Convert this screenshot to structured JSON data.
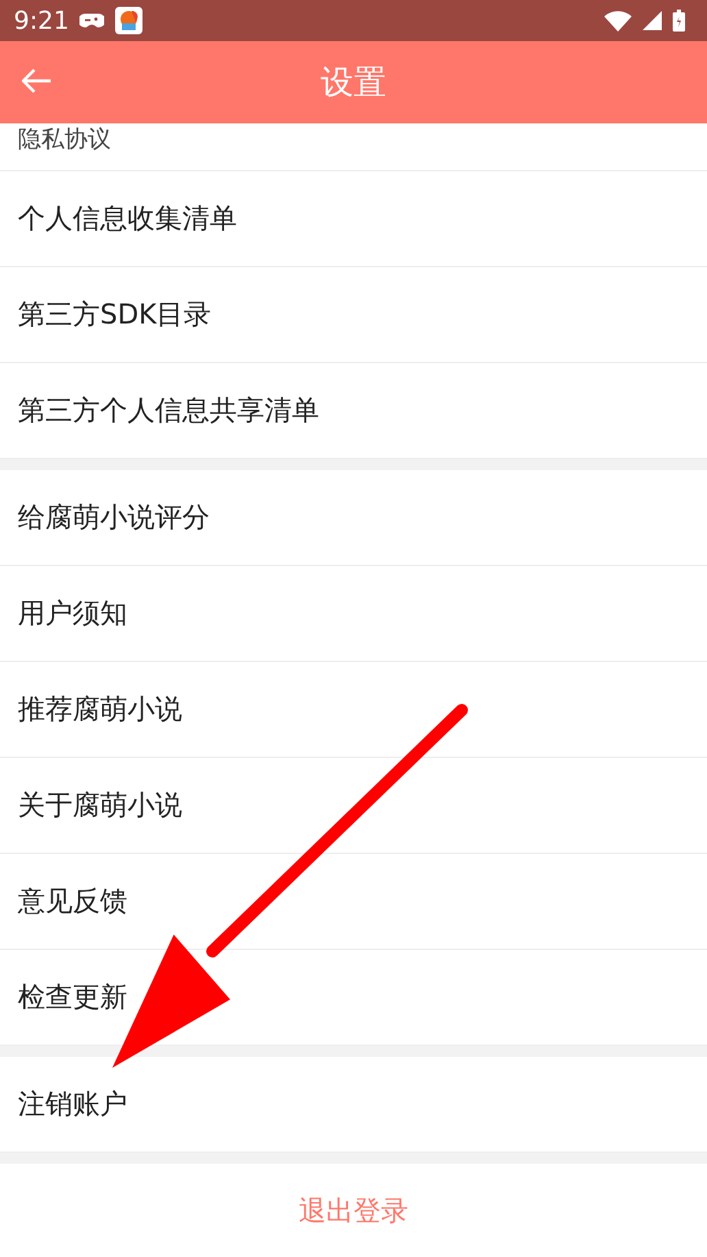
{
  "status_bar": {
    "time": "9:21"
  },
  "header": {
    "title": "设置"
  },
  "groups": [
    {
      "items": [
        {
          "label": "隐私协议",
          "kind": "partial"
        },
        {
          "label": "个人信息收集清单"
        },
        {
          "label": "第三方SDK目录"
        },
        {
          "label": "第三方个人信息共享清单"
        }
      ]
    },
    {
      "items": [
        {
          "label": "给腐萌小说评分"
        },
        {
          "label": "用户须知"
        },
        {
          "label": "推荐腐萌小说"
        },
        {
          "label": "关于腐萌小说"
        },
        {
          "label": "意见反馈"
        },
        {
          "label": "检查更新"
        }
      ]
    },
    {
      "items": [
        {
          "label": "注销账户"
        }
      ]
    }
  ],
  "logout_button": {
    "label": "退出登录"
  }
}
